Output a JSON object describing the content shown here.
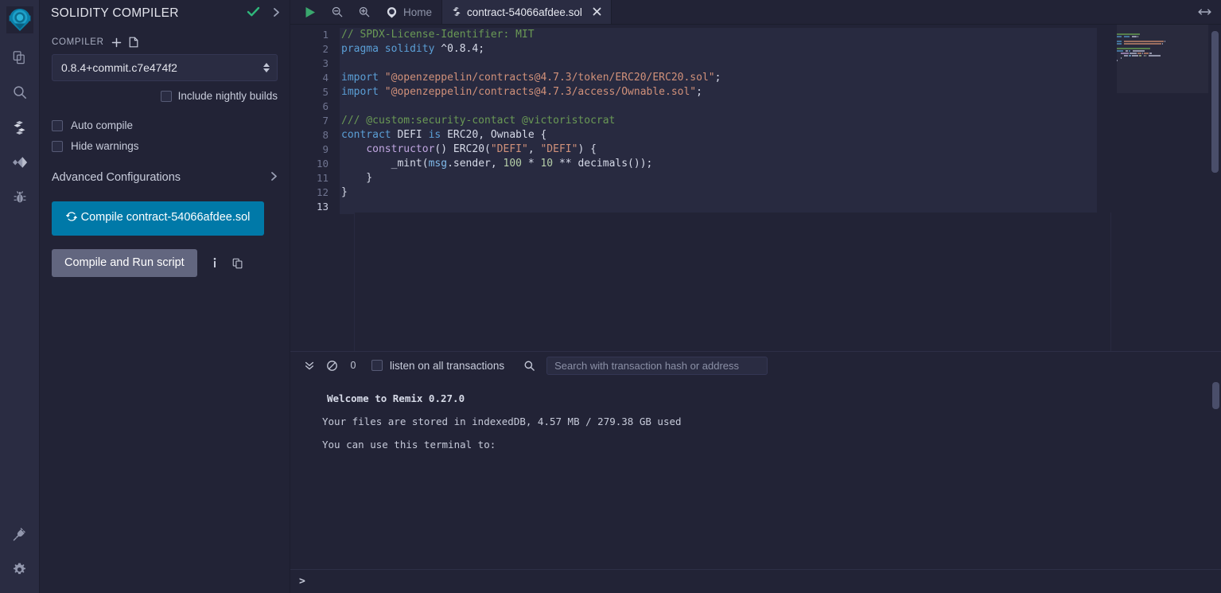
{
  "iconbar": {
    "logo_name": "remix-logo",
    "items": [
      {
        "name": "file-explorer-icon",
        "title": "File explorer"
      },
      {
        "name": "search-icon",
        "title": "Search in files"
      },
      {
        "name": "solidity-compiler-icon",
        "title": "Solidity compiler"
      },
      {
        "name": "deploy-run-icon",
        "title": "Deploy & run transactions"
      },
      {
        "name": "debugger-icon",
        "title": "Debugger"
      }
    ],
    "bottom_items": [
      {
        "name": "plugin-manager-icon",
        "title": "Plugin manager"
      },
      {
        "name": "settings-icon",
        "title": "Settings"
      }
    ]
  },
  "panel": {
    "title": "SOLIDITY COMPILER",
    "check_icon": "check-icon",
    "chevron_icon": "chevron-right-icon",
    "compiler_label": "COMPILER",
    "add_icon": "plus-icon",
    "file_icon": "file-icon",
    "compiler_version": "0.8.4+commit.c7e474f2",
    "nightly_label": "Include nightly builds",
    "auto_compile_label": "Auto compile",
    "hide_warnings_label": "Hide warnings",
    "advanced_label": "Advanced Configurations",
    "advanced_chevron": "chevron-right-icon",
    "compile_button_label": "Compile contract-54066afdee.sol",
    "compile_button_icon": "refresh-icon",
    "compile_button_color": "#0079a8",
    "run_button_label": "Compile and Run script",
    "run_info_icon": "info-icon",
    "run_copy_icon": "copy-icon"
  },
  "tabbar": {
    "run_icon": "play-icon",
    "zoom_out_icon": "zoom-out-icon",
    "zoom_in_icon": "zoom-in-icon",
    "home_tab": "Home",
    "home_icon": "remix-home-icon",
    "active_tab": "contract-54066afdee.sol",
    "active_tab_icon": "solidity-file-icon",
    "close_icon": "close-icon",
    "resize_icon": "horizontal-resize-icon"
  },
  "editor": {
    "line_numbers": [
      1,
      2,
      3,
      4,
      5,
      6,
      7,
      8,
      9,
      10,
      11,
      12,
      13
    ],
    "current_line": 13,
    "lines": [
      {
        "n": 1,
        "tokens": [
          {
            "t": "// SPDX-License-Identifier: MIT",
            "c": "c-com"
          }
        ]
      },
      {
        "n": 2,
        "tokens": [
          {
            "t": "pragma",
            "c": "c-key"
          },
          {
            "t": " ",
            "c": "c-pln"
          },
          {
            "t": "solidity",
            "c": "c-key"
          },
          {
            "t": " ",
            "c": "c-pln"
          },
          {
            "t": "^0.8.4",
            "c": "c-pln"
          },
          {
            "t": ";",
            "c": "c-pln"
          }
        ]
      },
      {
        "n": 3,
        "tokens": []
      },
      {
        "n": 4,
        "tokens": [
          {
            "t": "import",
            "c": "c-key"
          },
          {
            "t": " ",
            "c": "c-pln"
          },
          {
            "t": "\"@openzeppelin/contracts@4.7.3/token/ERC20/ERC20.sol\"",
            "c": "c-str"
          },
          {
            "t": ";",
            "c": "c-pln"
          }
        ]
      },
      {
        "n": 5,
        "tokens": [
          {
            "t": "import",
            "c": "c-key"
          },
          {
            "t": " ",
            "c": "c-pln"
          },
          {
            "t": "\"@openzeppelin/contracts@4.7.3/access/Ownable.sol\"",
            "c": "c-str"
          },
          {
            "t": ";",
            "c": "c-pln"
          }
        ]
      },
      {
        "n": 6,
        "tokens": []
      },
      {
        "n": 7,
        "tokens": [
          {
            "t": "/// @custom:security-contact @victoristocrat",
            "c": "c-com"
          }
        ]
      },
      {
        "n": 8,
        "tokens": [
          {
            "t": "contract",
            "c": "c-key"
          },
          {
            "t": " DEFI ",
            "c": "c-pln"
          },
          {
            "t": "is",
            "c": "c-key"
          },
          {
            "t": " ERC20, Ownable {",
            "c": "c-pln"
          }
        ]
      },
      {
        "n": 9,
        "tokens": [
          {
            "t": "    ",
            "c": "c-pln"
          },
          {
            "t": "constructor",
            "c": "c-fn"
          },
          {
            "t": "() ERC20(",
            "c": "c-pln"
          },
          {
            "t": "\"DEFI\"",
            "c": "c-str"
          },
          {
            "t": ", ",
            "c": "c-pln"
          },
          {
            "t": "\"DEFI\"",
            "c": "c-str"
          },
          {
            "t": ") {",
            "c": "c-pln"
          }
        ]
      },
      {
        "n": 10,
        "tokens": [
          {
            "t": "        _mint(",
            "c": "c-pln"
          },
          {
            "t": "msg",
            "c": "c-var"
          },
          {
            "t": ".sender, ",
            "c": "c-pln"
          },
          {
            "t": "100",
            "c": "c-num"
          },
          {
            "t": " * ",
            "c": "c-pln"
          },
          {
            "t": "10",
            "c": "c-num"
          },
          {
            "t": " ** decimals());",
            "c": "c-pln"
          }
        ]
      },
      {
        "n": 11,
        "tokens": [
          {
            "t": "    }",
            "c": "c-pln"
          }
        ]
      },
      {
        "n": 12,
        "tokens": [
          {
            "t": "}",
            "c": "c-pln"
          }
        ]
      },
      {
        "n": 13,
        "tokens": []
      }
    ],
    "minimap_name": "code-minimap",
    "scrollbar_name": "editor-vertical-scrollbar"
  },
  "terminal": {
    "collapse_icon": "chevrons-down-icon",
    "clear_icon": "no-entry-icon",
    "count": "0",
    "listen_label": "listen on all transactions",
    "search_icon": "search-icon",
    "search_placeholder": "Search with transaction hash or address",
    "search_value": "",
    "lines": [
      "Welcome to Remix 0.27.0",
      "Your files are stored in indexedDB, 4.57 MB / 279.38 GB used",
      "You can use this terminal to:"
    ],
    "prompt": ">"
  },
  "colors": {
    "accent": "#0079a8",
    "panel_bg": "#222336",
    "iconbar_bg": "#2a2c42",
    "editor_bg": "#222336",
    "code_band_bg": "#282a40",
    "success": "#2fb87b",
    "muted_button": "#62667f"
  }
}
